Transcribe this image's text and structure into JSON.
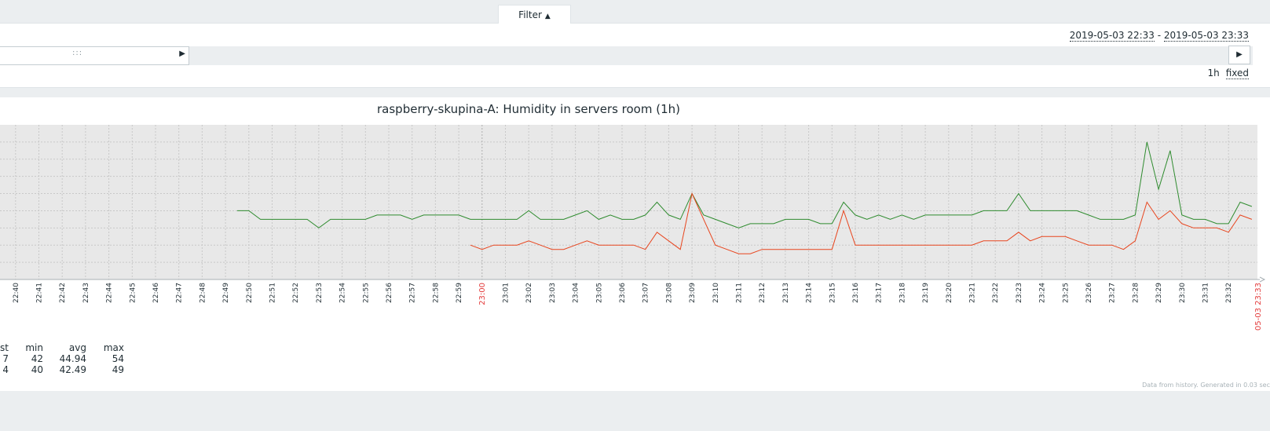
{
  "filter": {
    "label": "Filter",
    "arrow": "▲"
  },
  "time_range": {
    "from": "2019-05-03 22:33",
    "separator": " - ",
    "to": "2019-05-03 23:33"
  },
  "timeline": {
    "grip": ":::",
    "right_arrow": "▶",
    "end_arrow": "▶"
  },
  "period": {
    "value": "1h",
    "mode": "fixed"
  },
  "legend": {
    "headers": [
      "st",
      "min",
      "avg",
      "max"
    ],
    "rows": [
      {
        "series_color": "#2e8b2e",
        "last": "7",
        "min": "42",
        "avg": "44.94",
        "max": "54"
      },
      {
        "series_color": "#e8451e",
        "last": "4",
        "min": "40",
        "avg": "42.49",
        "max": "49"
      }
    ]
  },
  "footer": {
    "note": "Data from history. Generated in 0.03 sec"
  },
  "colors": {
    "series_green": "#2e8b2e",
    "series_red": "#e8451e",
    "plot_bg": "#e8e8e8",
    "grid": "#c8c8c8",
    "highlight_tick": "#e33b3b"
  },
  "chart_data": {
    "type": "line",
    "title": "raspberry-skupina-A: Humidity in servers room (1h)",
    "xlabel": "",
    "ylabel": "",
    "ylim": [
      37,
      55
    ],
    "grid": true,
    "x_ticks": [
      "22:40",
      "22:41",
      "22:42",
      "22:43",
      "22:44",
      "22:45",
      "22:46",
      "22:47",
      "22:48",
      "22:49",
      "22:50",
      "22:51",
      "22:52",
      "22:53",
      "22:54",
      "22:55",
      "22:56",
      "22:57",
      "22:58",
      "22:59",
      "23:00",
      "23:01",
      "23:02",
      "23:03",
      "23:04",
      "23:05",
      "23:06",
      "23:07",
      "23:08",
      "23:09",
      "23:10",
      "23:11",
      "23:12",
      "23:13",
      "23:14",
      "23:15",
      "23:16",
      "23:17",
      "23:18",
      "23:19",
      "23:20",
      "23:21",
      "23:22",
      "23:23",
      "23:24",
      "23:25",
      "23:26",
      "23:27",
      "23:28",
      "23:29",
      "23:30",
      "23:31",
      "23:32"
    ],
    "highlight_tick": "23:00",
    "end_tick": "05-03 23:33",
    "series": [
      {
        "color": "#2e8b2e",
        "x": [
          "22:49:30",
          "22:50:00",
          "22:50:30",
          "22:51:00",
          "22:52:00",
          "22:52:30",
          "22:53:00",
          "22:53:30",
          "22:54:00",
          "22:55:00",
          "22:55:30",
          "22:56:00",
          "22:56:30",
          "22:57:00",
          "22:57:30",
          "22:58:00",
          "22:59:00",
          "22:59:30",
          "23:00:00",
          "23:01:00",
          "23:01:30",
          "23:02:00",
          "23:02:30",
          "23:03:00",
          "23:03:30",
          "23:04:00",
          "23:04:30",
          "23:05:00",
          "23:05:30",
          "23:06:00",
          "23:06:30",
          "23:07:00",
          "23:07:30",
          "23:08:00",
          "23:08:30",
          "23:09:00",
          "23:09:30",
          "23:10:00",
          "23:10:30",
          "23:11:00",
          "23:11:30",
          "23:12:00",
          "23:12:30",
          "23:13:00",
          "23:13:30",
          "23:14:00",
          "23:14:30",
          "23:15:00",
          "23:15:30",
          "23:16:00",
          "23:16:30",
          "23:17:00",
          "23:17:30",
          "23:18:00",
          "23:18:30",
          "23:19:00",
          "23:20:00",
          "23:21:00",
          "23:21:30",
          "23:22:00",
          "23:22:30",
          "23:23:00",
          "23:23:30",
          "23:24:00",
          "23:25:00",
          "23:25:30",
          "23:26:00",
          "23:26:30",
          "23:27:00",
          "23:27:30",
          "23:28:00",
          "23:28:30",
          "23:29:00",
          "23:29:30",
          "23:30:00",
          "23:30:30",
          "23:31:00",
          "23:31:30",
          "23:32:00",
          "23:32:30",
          "23:33:00"
        ],
        "values": [
          45,
          45,
          44,
          44,
          44,
          44,
          43,
          44,
          44,
          44,
          44.5,
          44.5,
          44.5,
          44,
          44.5,
          44.5,
          44.5,
          44,
          44,
          44,
          44,
          45,
          44,
          44,
          44,
          44.5,
          45,
          44,
          44.5,
          44,
          44,
          44.5,
          46,
          44.5,
          44,
          47,
          44.5,
          44,
          43.5,
          43,
          43.5,
          43.5,
          43.5,
          44,
          44,
          44,
          43.5,
          43.5,
          46,
          44.5,
          44,
          44.5,
          44,
          44.5,
          44,
          44.5,
          44.5,
          44.5,
          45,
          45,
          45,
          47,
          45,
          45,
          45,
          45,
          44.5,
          44,
          44,
          44,
          44.5,
          53,
          47.5,
          52,
          44.5,
          44,
          44,
          43.5,
          43.5,
          46,
          45.5
        ]
      },
      {
        "color": "#e8451e",
        "x": [
          "22:59:30",
          "23:00:00",
          "23:00:30",
          "23:01:00",
          "23:01:30",
          "23:02:00",
          "23:02:30",
          "23:03:00",
          "23:03:30",
          "23:04:00",
          "23:04:30",
          "23:05:00",
          "23:05:30",
          "23:06:00",
          "23:06:30",
          "23:07:00",
          "23:07:30",
          "23:08:00",
          "23:08:30",
          "23:09:00",
          "23:09:30",
          "23:10:00",
          "23:10:30",
          "23:11:00",
          "23:11:30",
          "23:12:00",
          "23:12:30",
          "23:13:00",
          "23:13:30",
          "23:14:00",
          "23:14:30",
          "23:15:00",
          "23:15:30",
          "23:16:00",
          "23:17:00",
          "23:18:00",
          "23:19:00",
          "23:20:00",
          "23:21:00",
          "23:21:30",
          "23:22:00",
          "23:22:30",
          "23:23:00",
          "23:23:30",
          "23:24:00",
          "23:25:00",
          "23:25:30",
          "23:26:00",
          "23:26:30",
          "23:27:00",
          "23:27:30",
          "23:28:00",
          "23:28:30",
          "23:29:00",
          "23:29:30",
          "23:30:00",
          "23:30:30",
          "23:31:00",
          "23:31:30",
          "23:32:00",
          "23:32:30",
          "23:33:00"
        ],
        "values": [
          41,
          40.5,
          41,
          41,
          41,
          41.5,
          41,
          40.5,
          40.5,
          41,
          41.5,
          41,
          41,
          41,
          41,
          40.5,
          42.5,
          41.5,
          40.5,
          47,
          44,
          41,
          40.5,
          40,
          40,
          40.5,
          40.5,
          40.5,
          40.5,
          40.5,
          40.5,
          40.5,
          45,
          41,
          41,
          41,
          41,
          41,
          41,
          41.5,
          41.5,
          41.5,
          42.5,
          41.5,
          42,
          42,
          41.5,
          41,
          41,
          41,
          40.5,
          41.5,
          46,
          44,
          45,
          43.5,
          43,
          43,
          43,
          42.5,
          44.5,
          44
        ]
      }
    ]
  }
}
